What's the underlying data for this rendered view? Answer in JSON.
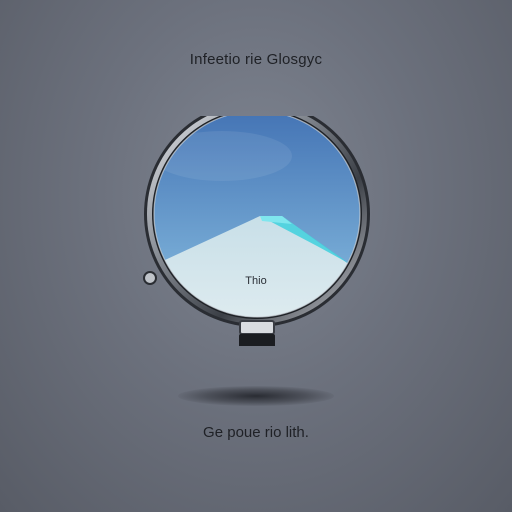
{
  "title": "Infeetio rie Glosgyc",
  "lens": {
    "label": "Thio",
    "colors": {
      "sky_top": "#4a7fbd",
      "sky_bottom": "#7fb0d8",
      "mountain": "#d6e7ec",
      "glacier_accent": "#39d4e0",
      "frame": "#2c2f34"
    }
  },
  "footer": "Ge poue rio lith."
}
